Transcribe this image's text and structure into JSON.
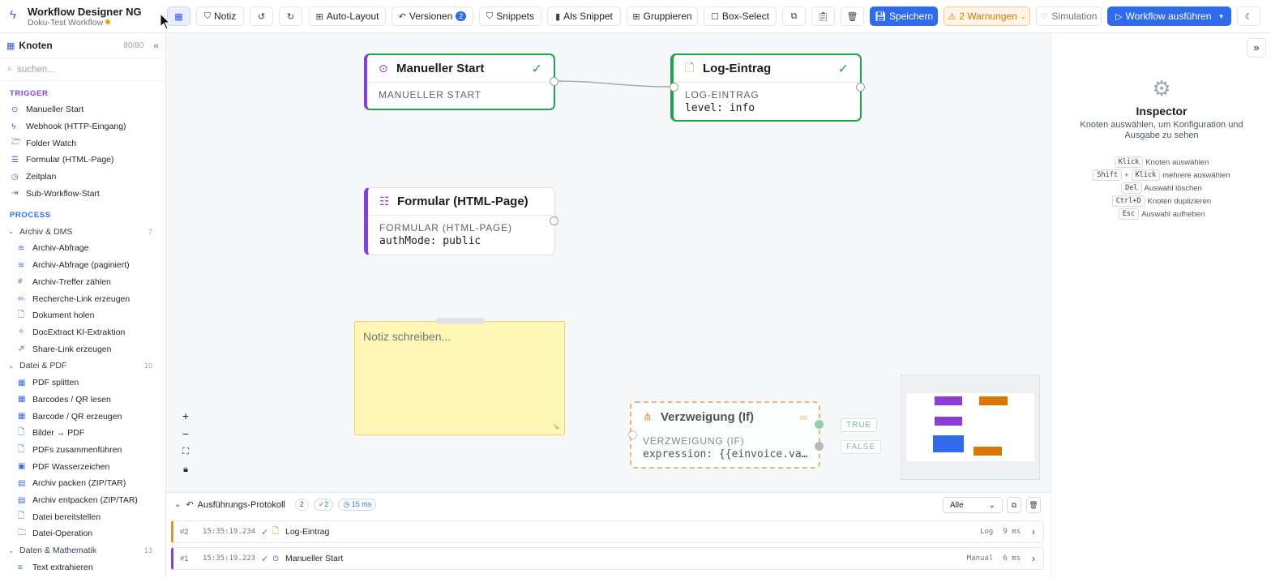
{
  "app": {
    "title": "Workflow Designer NG",
    "subtitle": "Doku-Test Workflow"
  },
  "toolbar": {
    "notiz": "Notiz",
    "auto_layout": "Auto-Layout",
    "versionen": "Versionen",
    "versionen_count": "2",
    "snippets": "Snippets",
    "als_snippet": "Als Snippet",
    "gruppieren": "Gruppieren",
    "box_select": "Box-Select",
    "speichern": "Speichern",
    "warnungen": "2 Warnungen",
    "simulation": "Simulation",
    "ausfuehren": "Workflow ausführen"
  },
  "sidebar": {
    "title": "Knoten",
    "count": "80/80",
    "search_placeholder": "suchen...",
    "trigger_label": "TRIGGER",
    "triggers": [
      {
        "label": "Manueller Start",
        "icon": "play-circle-icon"
      },
      {
        "label": "Webhook (HTTP-Eingang)",
        "icon": "bolt-icon"
      },
      {
        "label": "Folder Watch",
        "icon": "folder-icon"
      },
      {
        "label": "Formular (HTML-Page)",
        "icon": "list-icon"
      },
      {
        "label": "Zeitplan",
        "icon": "clock-icon"
      },
      {
        "label": "Sub-Workflow-Start",
        "icon": "enter-icon"
      }
    ],
    "process_label": "PROCESS",
    "groups": [
      {
        "label": "Archiv & DMS",
        "count": "7",
        "items": [
          "Archiv-Abfrage",
          "Archiv-Abfrage (paginiert)",
          "Archiv-Treffer zählen",
          "Recherche-Link erzeugen",
          "Dokument holen",
          "DocExtract KI-Extraktion",
          "Share-Link erzeugen"
        ]
      },
      {
        "label": "Datei & PDF",
        "count": "10",
        "items": [
          "PDF splitten",
          "Barcodes / QR lesen",
          "Barcode / QR erzeugen",
          "Bilder → PDF",
          "PDFs zusammenführen",
          "PDF Wasserzeichen",
          "Archiv packen (ZIP/TAR)",
          "Archiv entpacken (ZIP/TAR)",
          "Datei bereitstellen",
          "Datei-Operation"
        ]
      },
      {
        "label": "Daten & Mathematik",
        "count": "13",
        "items": [
          "Text extrahieren"
        ]
      }
    ]
  },
  "canvas": {
    "nodes": {
      "manual_start": {
        "title": "Manueller Start",
        "kind": "MANUELLER START"
      },
      "log": {
        "title": "Log-Eintrag",
        "kind": "LOG-EINTRAG",
        "value": "level: info"
      },
      "form": {
        "title": "Formular (HTML-Page)",
        "kind": "FORMULAR (HTML-PAGE)",
        "value": "authMode: public"
      },
      "branch": {
        "title": "Verzweigung (If)",
        "kind": "VERZWEIGUNG (IF)",
        "value": "expression: {{einvoice.va…"
      }
    },
    "note_placeholder": "Notiz schreiben...",
    "branch_true": "TRUE",
    "branch_false": "FALSE",
    "colors": {
      "trigger": "#8b3dd9",
      "success": "#22a34a",
      "warning": "#e8a25a",
      "primary": "#2f6bea",
      "orange": "#d97706"
    }
  },
  "inspector": {
    "title": "Inspector",
    "description": "Knoten auswählen, um Konfiguration und Ausgabe zu sehen",
    "shortcuts": [
      {
        "keys": [
          "Klick"
        ],
        "label": "Knoten auswählen"
      },
      {
        "keys": [
          "Shift",
          "Klick"
        ],
        "label": "mehrere auswählen"
      },
      {
        "keys": [
          "Del"
        ],
        "label": "Auswahl löschen"
      },
      {
        "keys": [
          "Ctrl+D"
        ],
        "label": "Knoten duplizieren"
      },
      {
        "keys": [
          "Esc"
        ],
        "label": "Auswahl aufheben"
      }
    ]
  },
  "log": {
    "title": "Ausführungs-Protokoll",
    "count": "2",
    "ok_count": "2",
    "duration": "15 ms",
    "filter": "Alle",
    "rows": [
      {
        "num": "#2",
        "time": "15:35:19.234",
        "name": "Log-Eintrag",
        "type": "Log",
        "duration": "9 ms"
      },
      {
        "num": "#1",
        "time": "15:35:19.223",
        "name": "Manueller Start",
        "type": "Manual",
        "duration": "6 ms"
      }
    ]
  }
}
